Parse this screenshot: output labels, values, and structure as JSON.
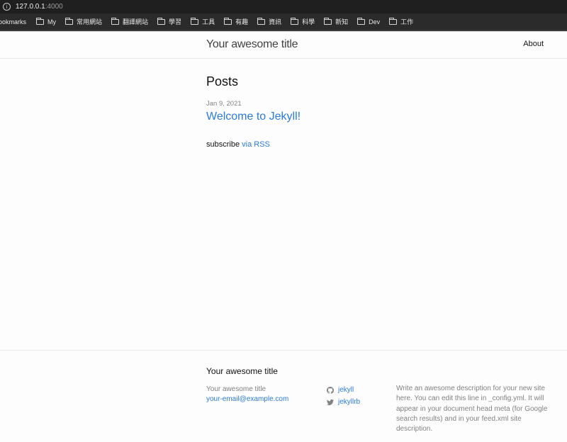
{
  "browser": {
    "url_host": "127.0.0.1",
    "url_port": ":4000",
    "bookmarks_label": "ookmarks",
    "bookmark_folders": [
      "My",
      "常用網站",
      "翻譯網站",
      "學習",
      "工具",
      "有趣",
      "資訊",
      "科學",
      "新知",
      "Dev",
      "工作"
    ]
  },
  "header": {
    "site_title": "Your awesome title",
    "nav_about": "About"
  },
  "main": {
    "heading": "Posts",
    "posts": [
      {
        "date": "Jan 9, 2021",
        "title": "Welcome to Jekyll!"
      }
    ],
    "subscribe_text": "subscribe",
    "subscribe_link": "via RSS"
  },
  "footer": {
    "heading": "Your awesome title",
    "title_line": "Your awesome title",
    "email": "your-email@example.com",
    "social": [
      {
        "icon": "github-icon",
        "label": "jekyll"
      },
      {
        "icon": "twitter-icon",
        "label": "jekyllrb"
      }
    ],
    "description": "Write an awesome description for your new site here. You can edit this line in _config.yml. It will appear in your document head meta (for Google search results) and in your feed.xml site description."
  }
}
